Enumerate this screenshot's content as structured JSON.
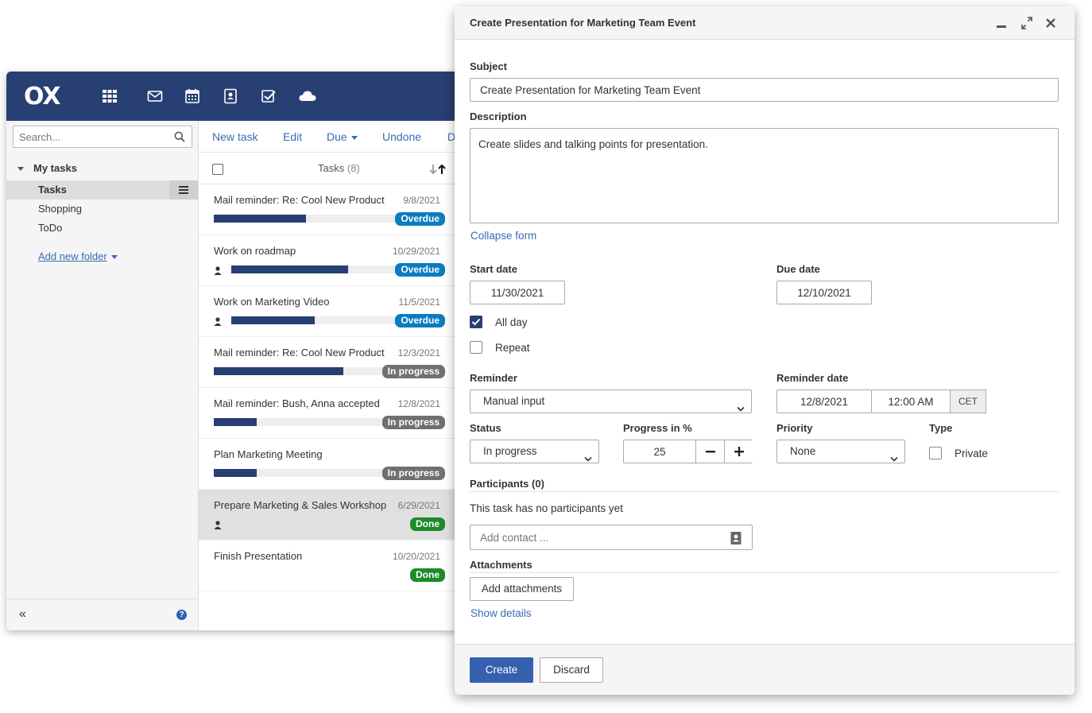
{
  "app": {
    "logo": "OX",
    "search": {
      "placeholder": "Search..."
    },
    "folders": {
      "header": "My tasks",
      "items": [
        "Tasks",
        "Shopping",
        "ToDo"
      ],
      "add_new": "Add new folder"
    },
    "toolbar": {
      "new_task": "New task",
      "edit": "Edit",
      "due": "Due",
      "undone": "Undone",
      "more": "D"
    },
    "list": {
      "title": "Tasks",
      "count": "(8)",
      "tasks": [
        {
          "name": "Mail reminder: Re: Cool New Product",
          "date": "9/8/2021",
          "status": "Overdue",
          "progress": 0.5,
          "person": false
        },
        {
          "name": "Work on roadmap",
          "date": "10/29/2021",
          "status": "Overdue",
          "progress": 0.7,
          "person": true
        },
        {
          "name": "Work on Marketing Video",
          "date": "11/5/2021",
          "status": "Overdue",
          "progress": 0.5,
          "person": true
        },
        {
          "name": "Mail reminder: Re: Cool New Product",
          "date": "12/3/2021",
          "status": "In progress",
          "progress": 0.75,
          "person": false
        },
        {
          "name": "Mail reminder: Bush, Anna accepted",
          "date": "12/8/2021",
          "status": "In progress",
          "progress": 0.25,
          "person": false
        },
        {
          "name": "Plan Marketing Meeting",
          "date": "",
          "status": "In progress",
          "progress": 0.25,
          "person": false
        },
        {
          "name": "Prepare Marketing & Sales Workshop",
          "date": "6/29/2021",
          "status": "Done",
          "progress": 0,
          "person": true
        },
        {
          "name": "Finish Presentation",
          "date": "10/20/2021",
          "status": "Done",
          "progress": 0,
          "person": false
        }
      ]
    }
  },
  "dialog": {
    "title": "Create Presentation for Marketing Team Event",
    "subject_label": "Subject",
    "subject_value": "Create Presentation for Marketing Team Event",
    "description_label": "Description",
    "description_value": "Create slides and talking points for presentation.",
    "collapse_form": "Collapse form",
    "start_date_label": "Start date",
    "start_date": "11/30/2021",
    "due_date_label": "Due date",
    "due_date": "12/10/2021",
    "all_day": "All day",
    "repeat": "Repeat",
    "reminder_label": "Reminder",
    "reminder_value": "Manual input",
    "reminder_date_label": "Reminder date",
    "reminder_date": "12/8/2021",
    "reminder_time": "12:00 AM",
    "timezone": "CET",
    "status_label": "Status",
    "status_value": "In progress",
    "progress_label": "Progress in %",
    "progress_value": "25",
    "priority_label": "Priority",
    "priority_value": "None",
    "type_label": "Type",
    "private": "Private",
    "participants_label": "Participants (0)",
    "no_participants": "This task has no participants yet",
    "add_contact_placeholder": "Add contact ...",
    "attachments_label": "Attachments",
    "add_attachments": "Add attachments",
    "show_details": "Show details",
    "create": "Create",
    "discard": "Discard"
  },
  "colors": {
    "topbar": "#283f73",
    "accent": "#3560ad",
    "overdue": "#0a7cbf",
    "in_progress": "#707070",
    "done": "#1d8a2b"
  }
}
